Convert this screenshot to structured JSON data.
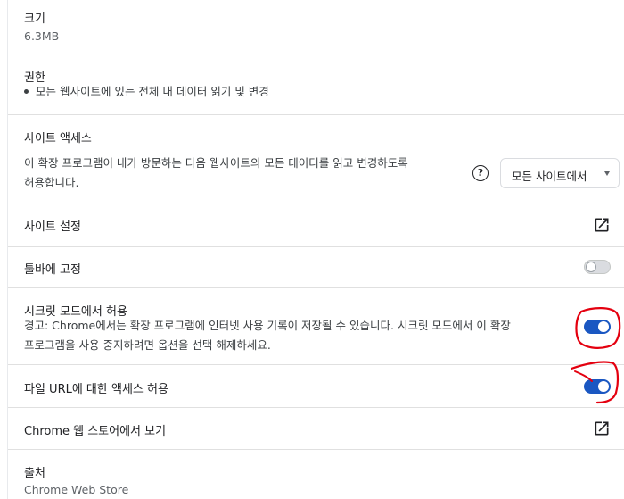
{
  "size": {
    "label": "크기",
    "value": "6.3MB"
  },
  "permissions": {
    "label": "권한",
    "items": [
      "모든 웹사이트에 있는 전체 내 데이터 읽기 및 변경"
    ]
  },
  "site_access": {
    "label": "사이트 액세스",
    "desc_line1": "이 확장 프로그램이 내가 방문하는 다음 웹사이트의 모든 데이터를 읽고 변경하도록",
    "desc_line2": "허용합니다.",
    "help_icon": "help-circle-icon",
    "select_value": "모든 사이트에서"
  },
  "site_settings": {
    "label": "사이트 설정",
    "icon": "open-in-new-icon"
  },
  "pin_toolbar": {
    "label": "툴바에 고정",
    "enabled": false
  },
  "incognito": {
    "label": "시크릿 모드에서 허용",
    "warning_line1": "경고: Chrome에서는 확장 프로그램에 인터넷 사용 기록이 저장될 수 있습니다. 시크릿 모드에서 이 확장",
    "warning_line2": "프로그램을 사용 중지하려면 옵션을 선택 해제하세요.",
    "enabled": true
  },
  "file_url": {
    "label": "파일 URL에 대한 액세스 허용",
    "enabled": true
  },
  "web_store": {
    "label": "Chrome 웹 스토어에서 보기",
    "icon": "open-in-new-icon"
  },
  "source": {
    "label": "출처",
    "value": "Chrome Web Store"
  },
  "colors": {
    "toggle_on": "#1a57c2",
    "annotation": "#e4000f",
    "divider": "#e0e0e0"
  }
}
